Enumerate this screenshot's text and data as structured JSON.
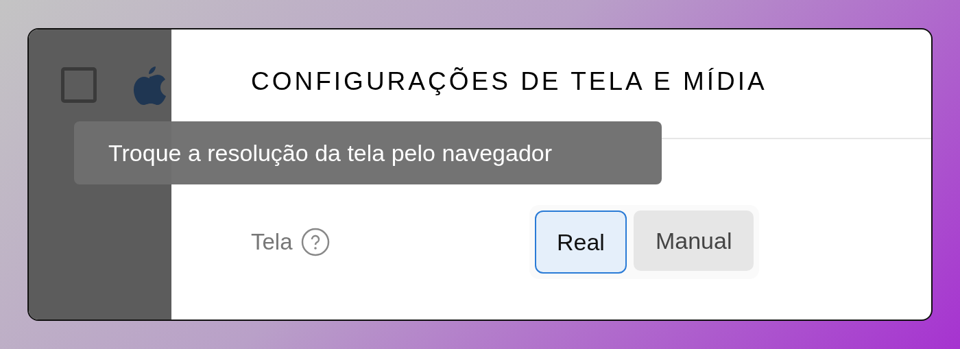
{
  "sidebar": {
    "checkbox": {
      "checked": false
    }
  },
  "panel": {
    "title": "CONFIGURAÇÕES DE TELA E MÍDIA"
  },
  "tooltip": {
    "text": "Troque a resolução da tela pelo navegador"
  },
  "setting": {
    "label": "Tela",
    "options": [
      {
        "label": "Real",
        "selected": true
      },
      {
        "label": "Manual",
        "selected": false
      }
    ]
  }
}
